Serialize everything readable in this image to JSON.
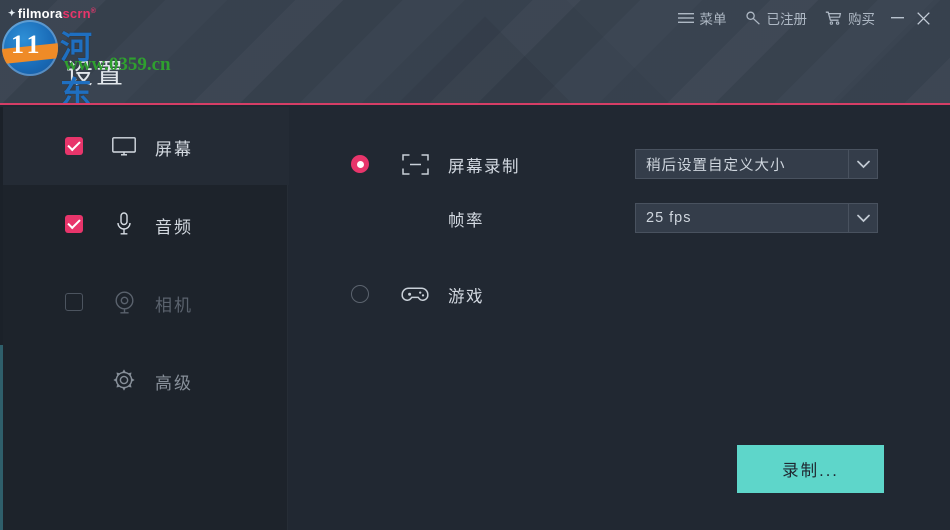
{
  "window": {
    "logo_star": "✦",
    "logo_primary": "filmora",
    "logo_secondary": "scrn",
    "logo_tm": "®",
    "title": "设置",
    "minimize_label": "—",
    "close_label": "✕"
  },
  "watermark": {
    "site_name": "河东软件园",
    "site_url": "www.0359.cn",
    "badge_text": "1 1"
  },
  "header": {
    "menu_label": "菜单",
    "menu_icon": "hamburger-menu-icon",
    "registered_label": "已注册",
    "registered_icon": "key-icon",
    "buy_label": "购买",
    "buy_icon": "shopping-cart-icon"
  },
  "sidebar": {
    "items": [
      {
        "label": "屏幕",
        "icon": "monitor-icon",
        "checked": true,
        "active": true,
        "disabled": false
      },
      {
        "label": "音频",
        "icon": "microphone-icon",
        "checked": true,
        "active": false,
        "disabled": false
      },
      {
        "label": "相机",
        "icon": "webcam-icon",
        "checked": false,
        "active": false,
        "disabled": true
      },
      {
        "label": "高级",
        "icon": "gear-icon",
        "checked": null,
        "active": false,
        "disabled": false
      }
    ]
  },
  "main": {
    "options": [
      {
        "label": "屏幕录制",
        "icon": "crop-frame-icon",
        "selected": true
      },
      {
        "label": "游戏",
        "icon": "gamepad-icon",
        "selected": false
      }
    ],
    "screen_capture": {
      "label": "屏幕录制",
      "dropdown_value": "稍后设置自定义大小",
      "dropdown_icon": "chevron-down-icon"
    },
    "frame_rate": {
      "label": "帧率",
      "dropdown_value": "25 fps",
      "dropdown_icon": "chevron-down-icon"
    },
    "game": {
      "label": "游戏"
    },
    "record_button_label": "录制..."
  },
  "colors": {
    "accent_pink": "#e8356b",
    "accent_teal": "#5ed6ca",
    "header_bg": "#38424f",
    "sidebar_bg": "#1d232b",
    "main_bg": "#212832",
    "watermark_blue": "#1f6fc0",
    "watermark_green": "#2fa02f",
    "watermark_orange": "#ef8b27"
  }
}
